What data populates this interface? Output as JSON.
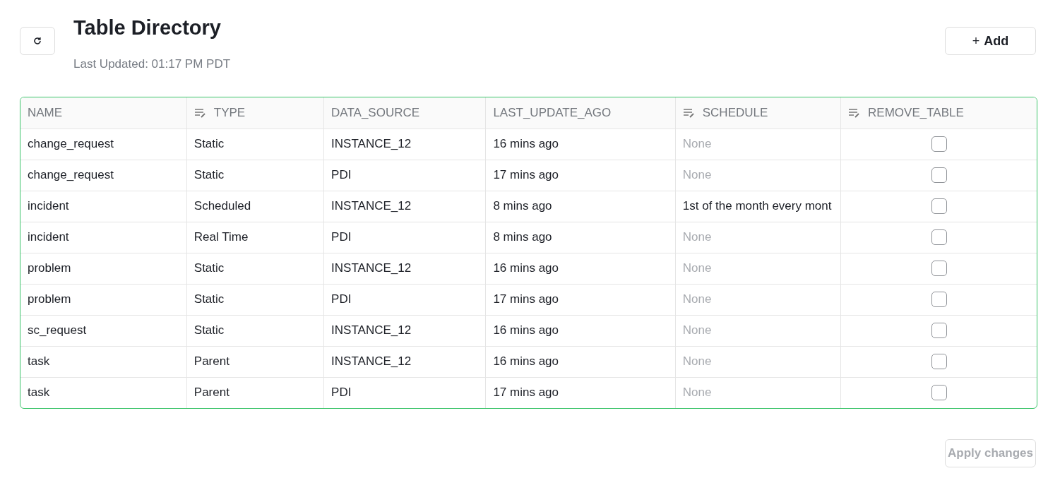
{
  "header": {
    "title": "Table Directory",
    "last_updated": "Last Updated: 01:17 PM PDT",
    "add_button": {
      "icon": "+",
      "label": "Add"
    }
  },
  "table": {
    "columns": [
      {
        "label": "NAME",
        "editable": false
      },
      {
        "label": "TYPE",
        "editable": true
      },
      {
        "label": "DATA_SOURCE",
        "editable": false
      },
      {
        "label": "LAST_UPDATE_AGO",
        "editable": false
      },
      {
        "label": "SCHEDULE",
        "editable": true
      },
      {
        "label": "REMOVE_TABLE",
        "editable": true
      }
    ],
    "rows": [
      {
        "name": "change_request",
        "type": "Static",
        "data_source": "INSTANCE_12",
        "last_update_ago": "16 mins ago",
        "schedule": {
          "text": "None",
          "is_default": true
        },
        "remove_checked": false
      },
      {
        "name": "change_request",
        "type": "Static",
        "data_source": "PDI",
        "last_update_ago": "17 mins ago",
        "schedule": {
          "text": "None",
          "is_default": true
        },
        "remove_checked": false
      },
      {
        "name": "incident",
        "type": "Scheduled",
        "data_source": "INSTANCE_12",
        "last_update_ago": "8 mins ago",
        "schedule": {
          "text": "1st of the month every mont",
          "is_default": false
        },
        "remove_checked": false
      },
      {
        "name": "incident",
        "type": "Real Time",
        "data_source": "PDI",
        "last_update_ago": "8 mins ago",
        "schedule": {
          "text": "None",
          "is_default": true
        },
        "remove_checked": false
      },
      {
        "name": "problem",
        "type": "Static",
        "data_source": "INSTANCE_12",
        "last_update_ago": "16 mins ago",
        "schedule": {
          "text": "None",
          "is_default": true
        },
        "remove_checked": false
      },
      {
        "name": "problem",
        "type": "Static",
        "data_source": "PDI",
        "last_update_ago": "17 mins ago",
        "schedule": {
          "text": "None",
          "is_default": true
        },
        "remove_checked": false
      },
      {
        "name": "sc_request",
        "type": "Static",
        "data_source": "INSTANCE_12",
        "last_update_ago": "16 mins ago",
        "schedule": {
          "text": "None",
          "is_default": true
        },
        "remove_checked": false
      },
      {
        "name": "task",
        "type": "Parent",
        "data_source": "INSTANCE_12",
        "last_update_ago": "16 mins ago",
        "schedule": {
          "text": "None",
          "is_default": true
        },
        "remove_checked": false
      },
      {
        "name": "task",
        "type": "Parent",
        "data_source": "PDI",
        "last_update_ago": "17 mins ago",
        "schedule": {
          "text": "None",
          "is_default": true
        },
        "remove_checked": false
      }
    ]
  },
  "apply_button": {
    "label": "Apply changes",
    "disabled": true
  }
}
